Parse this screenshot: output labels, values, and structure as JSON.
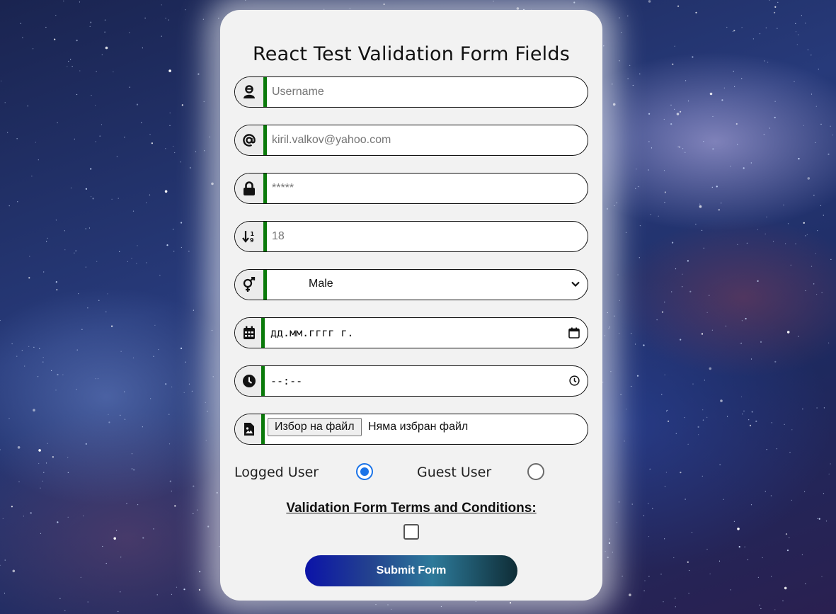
{
  "form": {
    "title": "React Test Validation Form Fields",
    "fields": {
      "username": {
        "placeholder": "Username",
        "icon": "user-icon"
      },
      "email": {
        "placeholder": "kiril.valkov@yahoo.com",
        "icon": "at-icon"
      },
      "password": {
        "placeholder": "*****",
        "icon": "lock-icon"
      },
      "age": {
        "placeholder": "18",
        "icon": "sort-numeric-icon"
      },
      "gender": {
        "selected": "Male",
        "icon": "gender-icon"
      },
      "date": {
        "placeholder": "дд.мм.гггг г.",
        "icon": "calendar-icon"
      },
      "time": {
        "placeholder": "--:--",
        "icon": "clock-icon"
      },
      "file": {
        "button_label": "Избор на файл",
        "status": "Няма избран файл",
        "icon": "image-file-icon"
      }
    },
    "user_type": {
      "options": [
        {
          "label": "Logged User",
          "checked": true
        },
        {
          "label": "Guest User",
          "checked": false
        }
      ]
    },
    "terms": {
      "label": "Validation Form Terms and Conditions:",
      "checked": false
    },
    "submit_label": "Submit Form"
  },
  "colors": {
    "field_accent": "#0a7a0a",
    "radio_accent": "#1a73e8",
    "card_background": "#f2f2f2"
  }
}
